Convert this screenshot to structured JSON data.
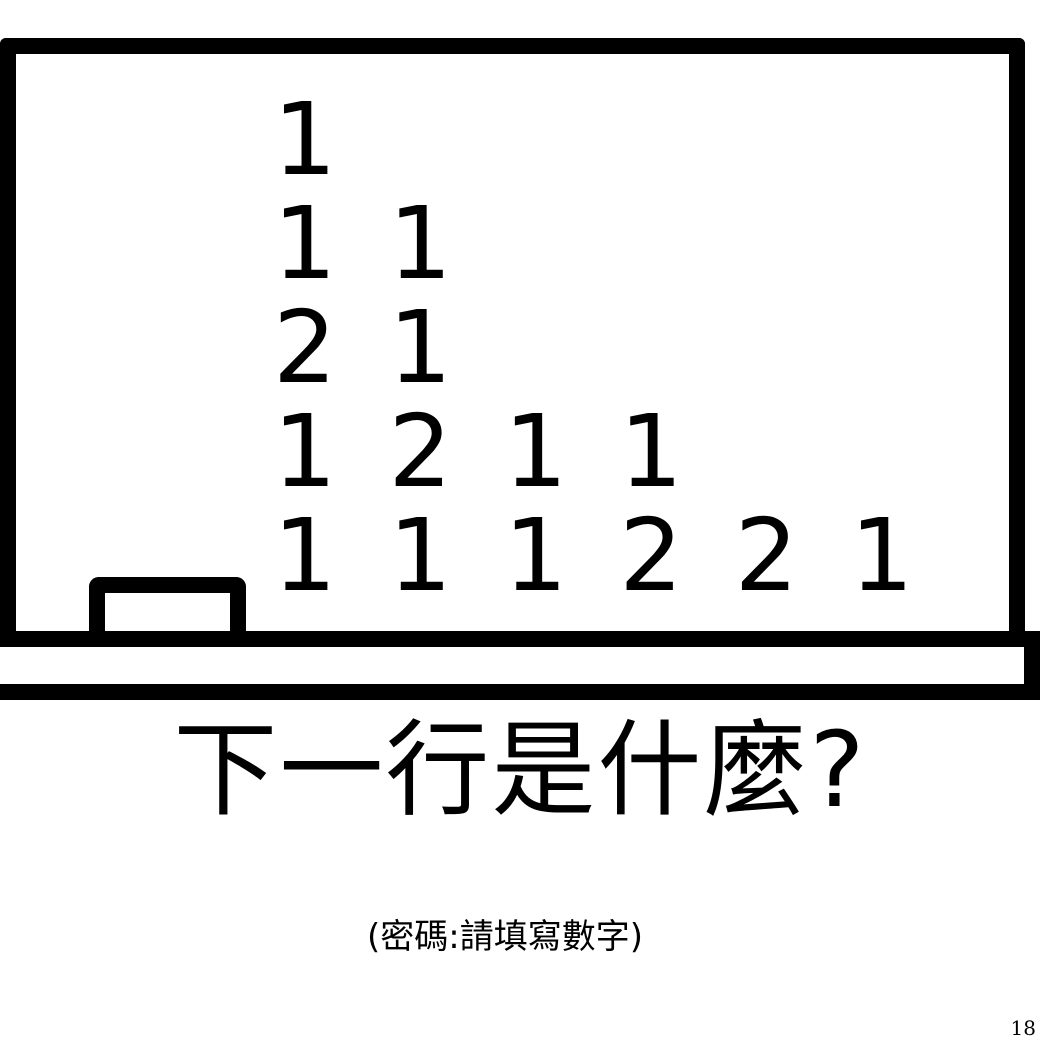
{
  "sequence_rows": [
    "1",
    "1 1",
    "2 1",
    "1 2 1 1",
    "1 1 1 2 2 1"
  ],
  "question": "下一行是什麼?",
  "hint": "(密碼:請填寫數字)",
  "page_number": "18"
}
